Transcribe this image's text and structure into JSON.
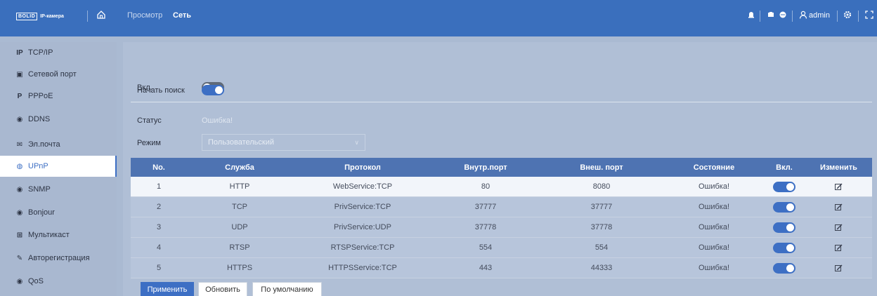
{
  "header": {
    "logo_brand": "BOLID",
    "logo_sub": "IP-камера",
    "nav": [
      "Просмотр",
      "Сеть"
    ],
    "user": "admin"
  },
  "sidebar": {
    "items": [
      {
        "icon": "IP",
        "label": "TCP/IP"
      },
      {
        "icon": "▣",
        "label": "Сетевой порт"
      },
      {
        "icon": "P",
        "label": "PPPoE"
      },
      {
        "icon": "◉",
        "label": "DDNS"
      },
      {
        "icon": "✉",
        "label": "Эл.почта"
      },
      {
        "icon": "◍",
        "label": "UPnP"
      },
      {
        "icon": "◉",
        "label": "SNMP"
      },
      {
        "icon": "◉",
        "label": "Bonjour"
      },
      {
        "icon": "⊞",
        "label": "Мультикаст"
      },
      {
        "icon": "✎",
        "label": "Авторегистрация"
      },
      {
        "icon": "◉",
        "label": "QoS"
      }
    ],
    "active": "UPnP"
  },
  "form": {
    "enable_label": "Вкл.",
    "enable_on": false,
    "search_label": "Начать поиск",
    "search_on": true,
    "status_label": "Статус",
    "status_value": "Ошибка!",
    "mode_label": "Режим",
    "mode_value": "Пользовательский"
  },
  "table": {
    "headers": [
      "No.",
      "Служба",
      "Протокол",
      "Внутр.порт",
      "Внеш. порт",
      "Состояние",
      "Вкл.",
      "Изменить"
    ],
    "rows": [
      {
        "no": "1",
        "service": "HTTP",
        "protocol": "WebService:TCP",
        "inner": "80",
        "outer": "8080",
        "state": "Ошибка!",
        "enabled": true
      },
      {
        "no": "2",
        "service": "TCP",
        "protocol": "PrivService:TCP",
        "inner": "37777",
        "outer": "37777",
        "state": "Ошибка!",
        "enabled": true
      },
      {
        "no": "3",
        "service": "UDP",
        "protocol": "PrivService:UDP",
        "inner": "37778",
        "outer": "37778",
        "state": "Ошибка!",
        "enabled": true
      },
      {
        "no": "4",
        "service": "RTSP",
        "protocol": "RTSPService:TCP",
        "inner": "554",
        "outer": "554",
        "state": "Ошибка!",
        "enabled": true
      },
      {
        "no": "5",
        "service": "HTTPS",
        "protocol": "HTTPSService:TCP",
        "inner": "443",
        "outer": "44333",
        "state": "Ошибка!",
        "enabled": true
      }
    ]
  },
  "buttons": {
    "apply": "Применить",
    "refresh": "Обновить",
    "default": "По умолчанию"
  },
  "colors": {
    "header_bg": "#3a6fbd",
    "accent": "#3d6fc4",
    "panel_bg": "#b0bfd6"
  }
}
